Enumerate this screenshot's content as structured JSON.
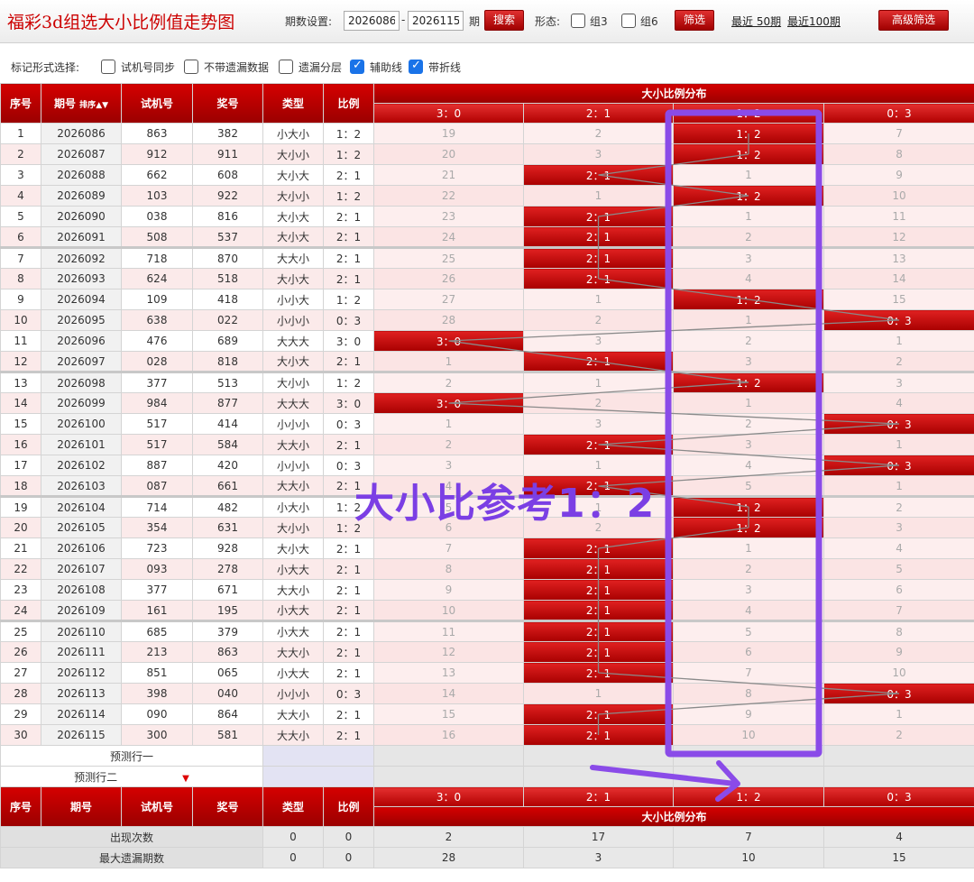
{
  "app": {
    "title": "福彩3d组选大小比例值走势图"
  },
  "toolbar": {
    "period_label": "期数设置:",
    "from": "2026086",
    "dash": "-",
    "to": "2026115",
    "period_unit": "期",
    "search_label": "搜索",
    "shape_label": "形态:",
    "group3_label": "组3",
    "group6_label": "组6",
    "filter_label": "筛选",
    "recent50_label": "最近 50期",
    "recent100_label": "最近100期",
    "advanced_label": "高级筛选"
  },
  "markbar": {
    "label": "标记形式选择:",
    "options": [
      {
        "label": "试机号同步",
        "checked": false
      },
      {
        "label": "不带遗漏数据",
        "checked": false
      },
      {
        "label": "遗漏分层",
        "checked": false
      },
      {
        "label": "辅助线",
        "checked": true
      },
      {
        "label": "带折线",
        "checked": true
      }
    ]
  },
  "headers": {
    "seq": "序号",
    "period": "期号",
    "sort": "排序",
    "test": "试机号",
    "prize": "奖号",
    "type": "类型",
    "ratio": "比例",
    "dist_title": "大小比例分布",
    "dist_cols": [
      "3：0",
      "2：1",
      "1：2",
      "0：3"
    ]
  },
  "rows": [
    {
      "seq": "1",
      "period": "2026086",
      "test": "863",
      "prize": "382",
      "type": "小大小",
      "ratio": "1：2",
      "dist": [
        "19",
        "2",
        "1：2",
        "7"
      ],
      "hit": 2
    },
    {
      "seq": "2",
      "period": "2026087",
      "test": "912",
      "prize": "911",
      "type": "大小小",
      "ratio": "1：2",
      "dist": [
        "20",
        "3",
        "1：2",
        "8"
      ],
      "hit": 2
    },
    {
      "seq": "3",
      "period": "2026088",
      "test": "662",
      "prize": "608",
      "type": "大小大",
      "ratio": "2：1",
      "dist": [
        "21",
        "2：1",
        "1",
        "9"
      ],
      "hit": 1
    },
    {
      "seq": "4",
      "period": "2026089",
      "test": "103",
      "prize": "922",
      "type": "大小小",
      "ratio": "1：2",
      "dist": [
        "22",
        "1",
        "1：2",
        "10"
      ],
      "hit": 2
    },
    {
      "seq": "5",
      "period": "2026090",
      "test": "038",
      "prize": "816",
      "type": "大小大",
      "ratio": "2：1",
      "dist": [
        "23",
        "2：1",
        "1",
        "11"
      ],
      "hit": 1
    },
    {
      "seq": "6",
      "period": "2026091",
      "test": "508",
      "prize": "537",
      "type": "大小大",
      "ratio": "2：1",
      "dist": [
        "24",
        "2：1",
        "2",
        "12"
      ],
      "hit": 1
    },
    {
      "seq": "7",
      "period": "2026092",
      "test": "718",
      "prize": "870",
      "type": "大大小",
      "ratio": "2：1",
      "dist": [
        "25",
        "2：1",
        "3",
        "13"
      ],
      "hit": 1
    },
    {
      "seq": "8",
      "period": "2026093",
      "test": "624",
      "prize": "518",
      "type": "大小大",
      "ratio": "2：1",
      "dist": [
        "26",
        "2：1",
        "4",
        "14"
      ],
      "hit": 1
    },
    {
      "seq": "9",
      "period": "2026094",
      "test": "109",
      "prize": "418",
      "type": "小小大",
      "ratio": "1：2",
      "dist": [
        "27",
        "1",
        "1：2",
        "15"
      ],
      "hit": 2
    },
    {
      "seq": "10",
      "period": "2026095",
      "test": "638",
      "prize": "022",
      "type": "小小小",
      "ratio": "0：3",
      "dist": [
        "28",
        "2",
        "1",
        "0：3"
      ],
      "hit": 3
    },
    {
      "seq": "11",
      "period": "2026096",
      "test": "476",
      "prize": "689",
      "type": "大大大",
      "ratio": "3：0",
      "dist": [
        "3：0",
        "3",
        "2",
        "1"
      ],
      "hit": 0
    },
    {
      "seq": "12",
      "period": "2026097",
      "test": "028",
      "prize": "818",
      "type": "大小大",
      "ratio": "2：1",
      "dist": [
        "1",
        "2：1",
        "3",
        "2"
      ],
      "hit": 1
    },
    {
      "seq": "13",
      "period": "2026098",
      "test": "377",
      "prize": "513",
      "type": "大小小",
      "ratio": "1：2",
      "dist": [
        "2",
        "1",
        "1：2",
        "3"
      ],
      "hit": 2
    },
    {
      "seq": "14",
      "period": "2026099",
      "test": "984",
      "prize": "877",
      "type": "大大大",
      "ratio": "3：0",
      "dist": [
        "3：0",
        "2",
        "1",
        "4"
      ],
      "hit": 0
    },
    {
      "seq": "15",
      "period": "2026100",
      "test": "517",
      "prize": "414",
      "type": "小小小",
      "ratio": "0：3",
      "dist": [
        "1",
        "3",
        "2",
        "0：3"
      ],
      "hit": 3
    },
    {
      "seq": "16",
      "period": "2026101",
      "test": "517",
      "prize": "584",
      "type": "大大小",
      "ratio": "2：1",
      "dist": [
        "2",
        "2：1",
        "3",
        "1"
      ],
      "hit": 1
    },
    {
      "seq": "17",
      "period": "2026102",
      "test": "887",
      "prize": "420",
      "type": "小小小",
      "ratio": "0：3",
      "dist": [
        "3",
        "1",
        "4",
        "0：3"
      ],
      "hit": 3
    },
    {
      "seq": "18",
      "period": "2026103",
      "test": "087",
      "prize": "661",
      "type": "大大小",
      "ratio": "2：1",
      "dist": [
        "4",
        "2：1",
        "5",
        "1"
      ],
      "hit": 1
    },
    {
      "seq": "19",
      "period": "2026104",
      "test": "714",
      "prize": "482",
      "type": "小大小",
      "ratio": "1：2",
      "dist": [
        "5",
        "1",
        "1：2",
        "2"
      ],
      "hit": 2
    },
    {
      "seq": "20",
      "period": "2026105",
      "test": "354",
      "prize": "631",
      "type": "大小小",
      "ratio": "1：2",
      "dist": [
        "6",
        "2",
        "1：2",
        "3"
      ],
      "hit": 2
    },
    {
      "seq": "21",
      "period": "2026106",
      "test": "723",
      "prize": "928",
      "type": "大小大",
      "ratio": "2：1",
      "dist": [
        "7",
        "2：1",
        "1",
        "4"
      ],
      "hit": 1
    },
    {
      "seq": "22",
      "period": "2026107",
      "test": "093",
      "prize": "278",
      "type": "小大大",
      "ratio": "2：1",
      "dist": [
        "8",
        "2：1",
        "2",
        "5"
      ],
      "hit": 1
    },
    {
      "seq": "23",
      "period": "2026108",
      "test": "377",
      "prize": "671",
      "type": "大大小",
      "ratio": "2：1",
      "dist": [
        "9",
        "2：1",
        "3",
        "6"
      ],
      "hit": 1
    },
    {
      "seq": "24",
      "period": "2026109",
      "test": "161",
      "prize": "195",
      "type": "小大大",
      "ratio": "2：1",
      "dist": [
        "10",
        "2：1",
        "4",
        "7"
      ],
      "hit": 1
    },
    {
      "seq": "25",
      "period": "2026110",
      "test": "685",
      "prize": "379",
      "type": "小大大",
      "ratio": "2：1",
      "dist": [
        "11",
        "2：1",
        "5",
        "8"
      ],
      "hit": 1
    },
    {
      "seq": "26",
      "period": "2026111",
      "test": "213",
      "prize": "863",
      "type": "大大小",
      "ratio": "2：1",
      "dist": [
        "12",
        "2：1",
        "6",
        "9"
      ],
      "hit": 1
    },
    {
      "seq": "27",
      "period": "2026112",
      "test": "851",
      "prize": "065",
      "type": "小大大",
      "ratio": "2：1",
      "dist": [
        "13",
        "2：1",
        "7",
        "10"
      ],
      "hit": 1
    },
    {
      "seq": "28",
      "period": "2026113",
      "test": "398",
      "prize": "040",
      "type": "小小小",
      "ratio": "0：3",
      "dist": [
        "14",
        "1",
        "8",
        "0：3"
      ],
      "hit": 3
    },
    {
      "seq": "29",
      "period": "2026114",
      "test": "090",
      "prize": "864",
      "type": "大大小",
      "ratio": "2：1",
      "dist": [
        "15",
        "2：1",
        "9",
        "1"
      ],
      "hit": 1
    },
    {
      "seq": "30",
      "period": "2026115",
      "test": "300",
      "prize": "581",
      "type": "大大小",
      "ratio": "2：1",
      "dist": [
        "16",
        "2：1",
        "10",
        "2"
      ],
      "hit": 1
    }
  ],
  "predict": {
    "row1": "预测行一",
    "row2": "预测行二"
  },
  "stats": [
    {
      "label": "出现次数",
      "type": "0",
      "ratio": "0",
      "dist": [
        "2",
        "17",
        "7",
        "4"
      ]
    },
    {
      "label": "最大遗漏期数",
      "type": "0",
      "ratio": "0",
      "dist": [
        "28",
        "3",
        "10",
        "15"
      ]
    }
  ],
  "annotation": {
    "text": "大小比参考1：2",
    "color": "#7b3fe4"
  },
  "colors": {
    "brand_red": "#c00000",
    "hit_red": "#d01010",
    "annotation_purple": "#8a4be8"
  }
}
